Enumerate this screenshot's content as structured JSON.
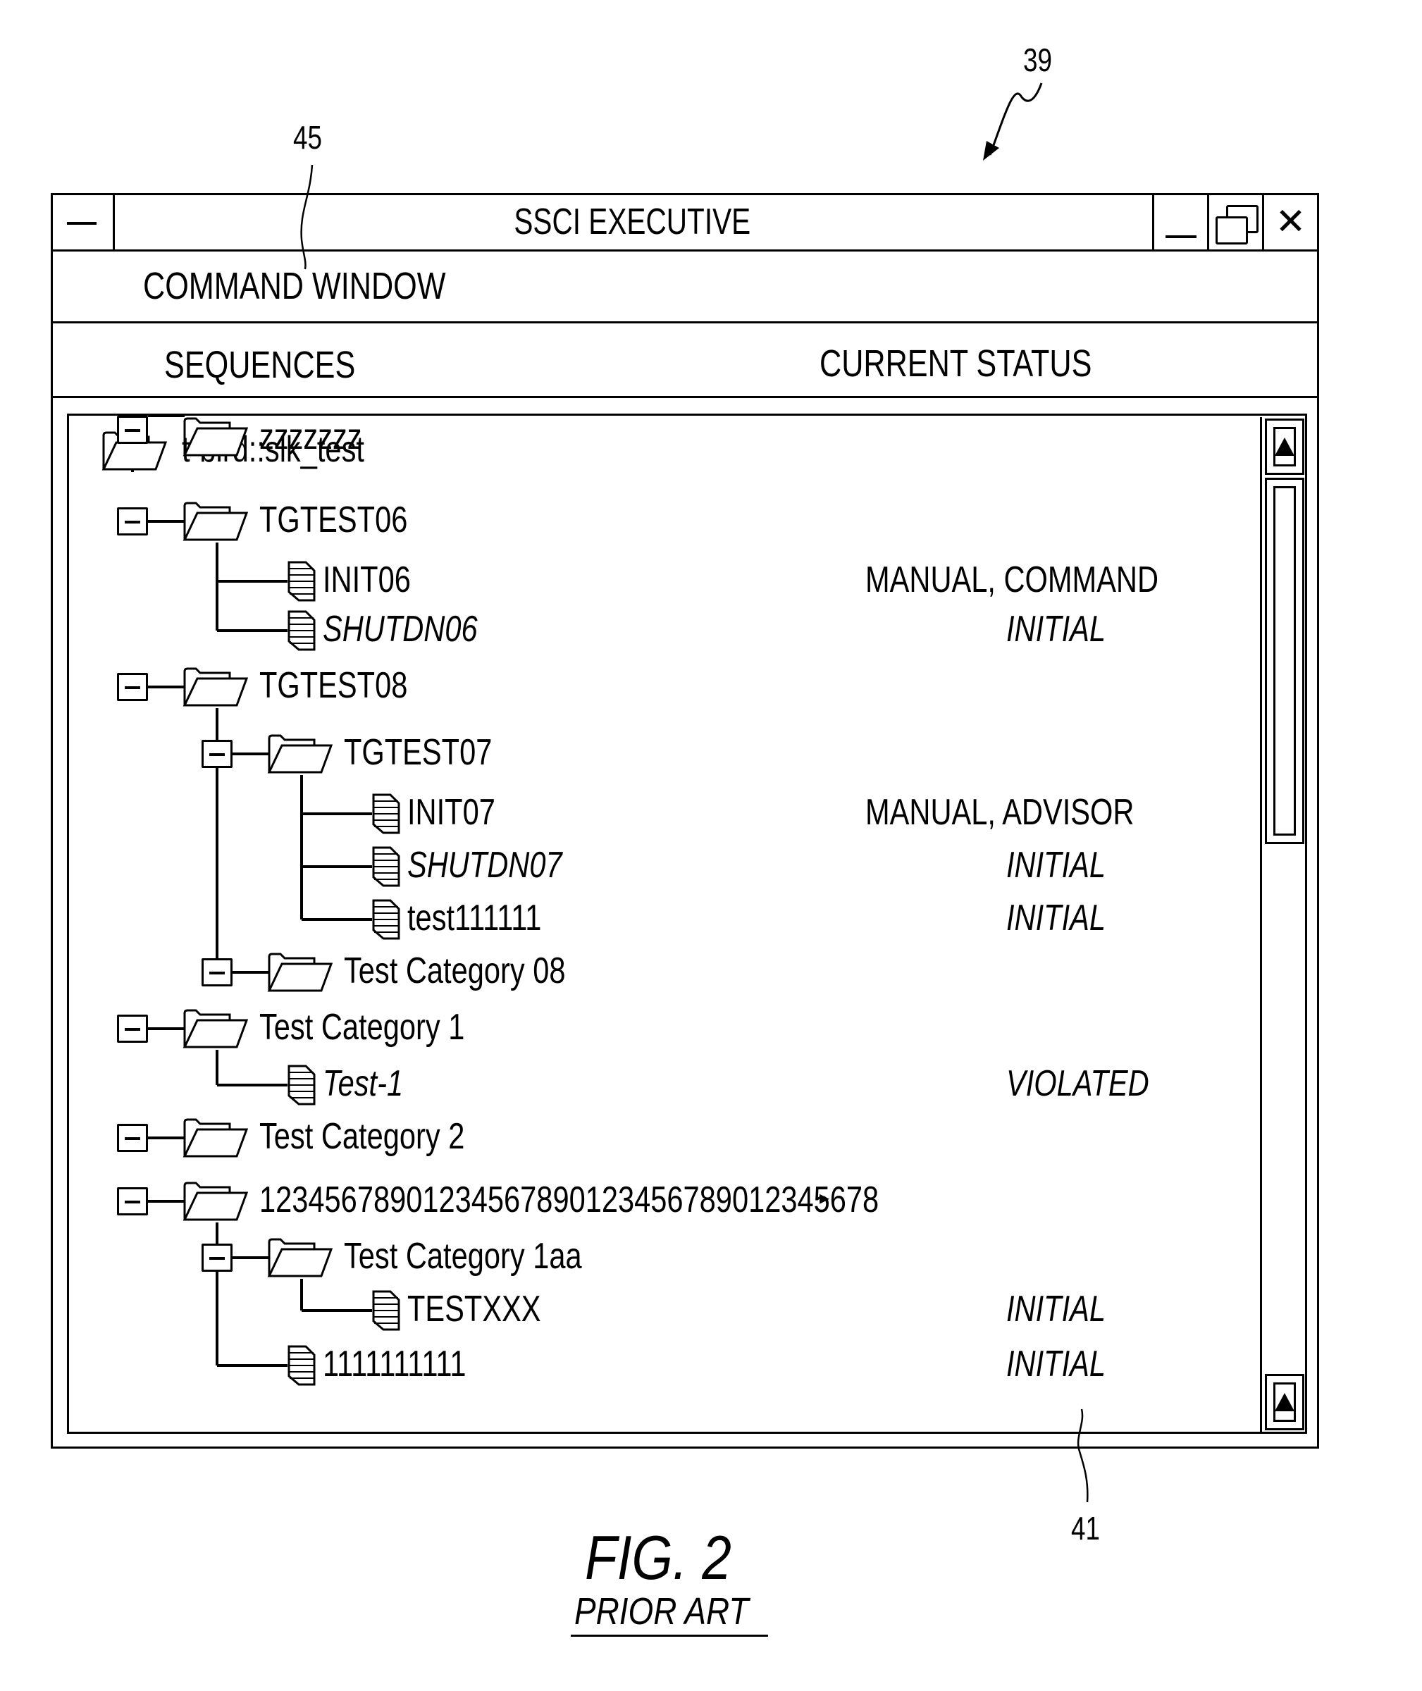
{
  "annotations": {
    "window_ref": "39",
    "command_window_ref": "45",
    "tree_pane_ref": "41"
  },
  "window": {
    "title": "SSCI EXECUTIVE",
    "icons": {
      "system_menu": "system-menu-icon",
      "minimize": "minimize-icon",
      "restore": "restore-icon",
      "close": "close-icon"
    },
    "close_glyph": "✕"
  },
  "menubar": {
    "command_window": "COMMAND WINDOW"
  },
  "columns": {
    "sequences": "SEQUENCES",
    "current_status": "CURRENT STATUS"
  },
  "tree": {
    "root": {
      "label": "t-bird::slk_test",
      "type": "folder"
    },
    "nodes": [
      {
        "label": "TGTEST06",
        "type": "folder",
        "depth": 1,
        "expanded": true,
        "status": ""
      },
      {
        "label": "INIT06",
        "type": "sequence",
        "depth": 2,
        "italic": false,
        "status": "MANUAL, COMMAND",
        "status_italic": false
      },
      {
        "label": "SHUTDN06",
        "type": "sequence",
        "depth": 2,
        "italic": true,
        "status": "INITIAL",
        "status_italic": true
      },
      {
        "label": "TGTEST08",
        "type": "folder",
        "depth": 1,
        "expanded": true,
        "status": ""
      },
      {
        "label": "TGTEST07",
        "type": "folder",
        "depth": 2,
        "expanded": true,
        "status": ""
      },
      {
        "label": "INIT07",
        "type": "sequence",
        "depth": 3,
        "italic": false,
        "status": "MANUAL, ADVISOR",
        "status_italic": false
      },
      {
        "label": "SHUTDN07",
        "type": "sequence",
        "depth": 3,
        "italic": true,
        "status": "INITIAL",
        "status_italic": true
      },
      {
        "label": "test111111",
        "type": "sequence",
        "depth": 3,
        "italic": false,
        "status": "INITIAL",
        "status_italic": true
      },
      {
        "label": "Test Category 08",
        "type": "folder",
        "depth": 2,
        "expanded": true,
        "status": ""
      },
      {
        "label": "Test Category 1",
        "type": "folder",
        "depth": 1,
        "expanded": true,
        "status": ""
      },
      {
        "label": "Test-1",
        "type": "sequence",
        "depth": 2,
        "italic": true,
        "status": "VIOLATED",
        "status_italic": true
      },
      {
        "label": "Test Category 2",
        "type": "folder",
        "depth": 1,
        "expanded": true,
        "status": ""
      },
      {
        "label": "12345678901234567890123456789012345678",
        "type": "folder",
        "depth": 1,
        "expanded": true,
        "truncated": true,
        "status": ""
      },
      {
        "label": "Test Category 1aa",
        "type": "folder",
        "depth": 2,
        "expanded": true,
        "status": ""
      },
      {
        "label": "TESTXXX",
        "type": "sequence",
        "depth": 3,
        "italic": false,
        "status": "INITIAL",
        "status_italic": true
      },
      {
        "label": "1111111111",
        "type": "sequence",
        "depth": 2,
        "italic": false,
        "status": "INITIAL",
        "status_italic": true
      },
      {
        "label": "zzzzzzz",
        "type": "folder",
        "depth": 1,
        "expanded": true,
        "status": ""
      }
    ],
    "truncated_text": "12345678901234567890123456789012345678",
    "truncation_marker": "▸"
  },
  "scrollbar": {
    "up_icon": "arrow-up-icon",
    "down_icon": "arrow-up-icon"
  },
  "caption": {
    "figure": "FIG. 2",
    "subtitle": "PRIOR ART"
  }
}
